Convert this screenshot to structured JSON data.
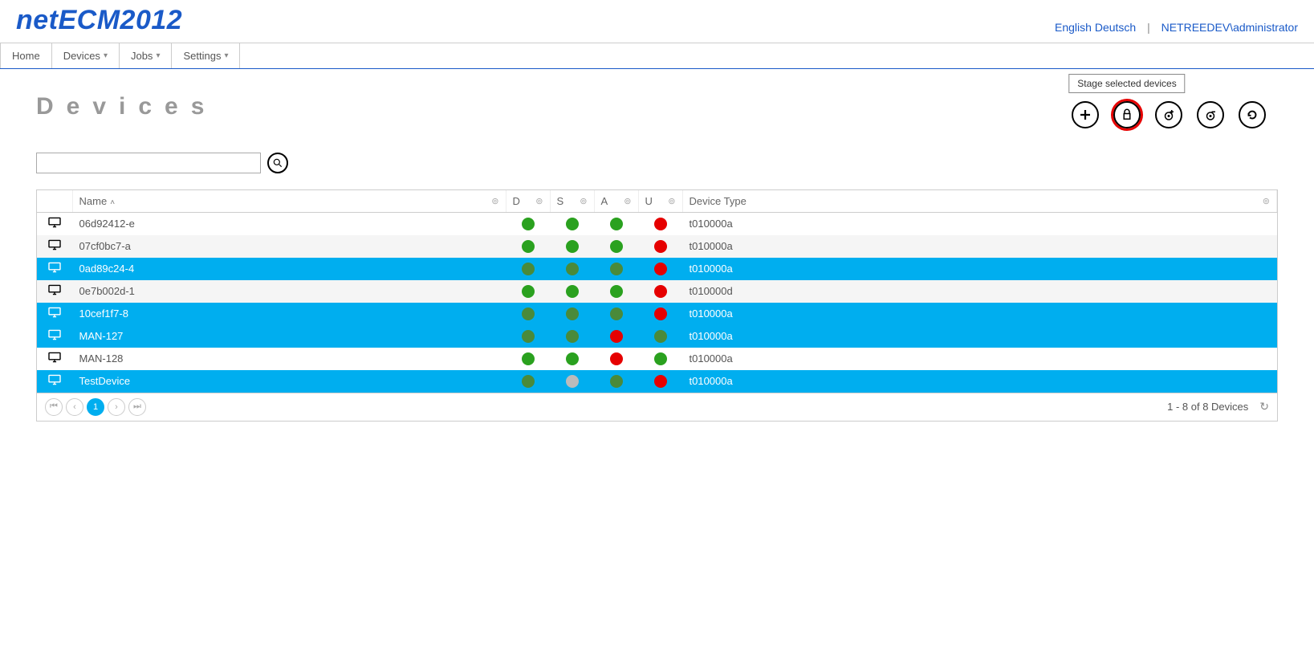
{
  "app": {
    "name": "netECM2012"
  },
  "top_right": {
    "lang1": "English",
    "lang2": "Deutsch",
    "user": "NETREEDEV\\administrator"
  },
  "menu": {
    "home": "Home",
    "devices": "Devices",
    "jobs": "Jobs",
    "settings": "Settings"
  },
  "page": {
    "title": "Devices",
    "search_placeholder": ""
  },
  "tooltip": {
    "stage": "Stage selected devices"
  },
  "columns": {
    "name": "Name",
    "d": "D",
    "s": "S",
    "a": "A",
    "u": "U",
    "type": "Device Type"
  },
  "rows": [
    {
      "name": "06d92412-e",
      "d": "green",
      "s": "green",
      "a": "green",
      "u": "red",
      "type": "t010000a",
      "sel": false,
      "alt": false
    },
    {
      "name": "07cf0bc7-a",
      "d": "green",
      "s": "green",
      "a": "green",
      "u": "red",
      "type": "t010000a",
      "sel": false,
      "alt": true
    },
    {
      "name": "0ad89c24-4",
      "d": "dgreen",
      "s": "dgreen",
      "a": "dgreen",
      "u": "red",
      "type": "t010000a",
      "sel": true,
      "alt": false
    },
    {
      "name": "0e7b002d-1",
      "d": "green",
      "s": "green",
      "a": "green",
      "u": "red",
      "type": "t010000d",
      "sel": false,
      "alt": true
    },
    {
      "name": "10cef1f7-8",
      "d": "dgreen",
      "s": "dgreen",
      "a": "dgreen",
      "u": "red",
      "type": "t010000a",
      "sel": true,
      "alt": false
    },
    {
      "name": "MAN-127",
      "d": "dgreen",
      "s": "dgreen",
      "a": "red",
      "u": "dgreen",
      "type": "t010000a",
      "sel": true,
      "alt": false
    },
    {
      "name": "MAN-128",
      "d": "green",
      "s": "green",
      "a": "red",
      "u": "green",
      "type": "t010000a",
      "sel": false,
      "alt": false
    },
    {
      "name": "TestDevice",
      "d": "dgreen",
      "s": "gray",
      "a": "dgreen",
      "u": "red",
      "type": "t010000a",
      "sel": true,
      "alt": false
    }
  ],
  "pager": {
    "page": "1",
    "status": "1 - 8 of 8 Devices"
  }
}
